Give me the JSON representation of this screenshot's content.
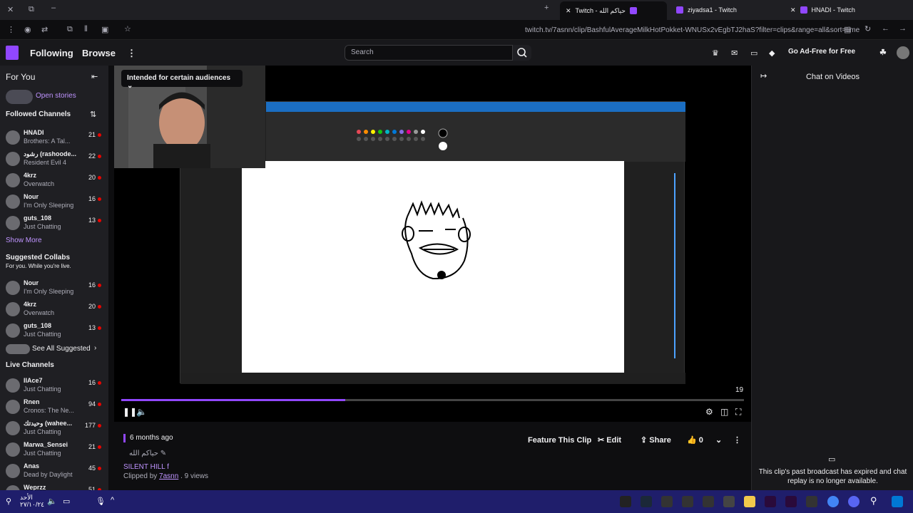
{
  "browser": {
    "tabs": [
      {
        "label": "Twitch - حياكم الله",
        "active": true
      },
      {
        "label": "ziyadsa1 - Twitch"
      },
      {
        "label": "HNADI - Twitch"
      }
    ],
    "url": "twitch.tv/7asnn/clip/BashfulAverageMilkHotPokket-WNUSx2vEgbTJ2haS?filter=clips&range=all&sort=time"
  },
  "topnav": {
    "following": "Following",
    "browse": "Browse",
    "search_placeholder": "Search",
    "adfree": "Go Ad-Free for Free"
  },
  "sidebar": {
    "for_you": "For You",
    "open_stories": "Open stories",
    "followed_heading": "Followed Channels",
    "followed": [
      {
        "name": "HNADI",
        "game": "Brothers: A Tal...",
        "viewers": "21"
      },
      {
        "name": "رشود (rashoode...",
        "game": "Resident Evil 4",
        "viewers": "22"
      },
      {
        "name": "4krz",
        "game": "Overwatch",
        "viewers": "20"
      },
      {
        "name": "Nour",
        "game": "I'm Only Sleeping",
        "viewers": "16"
      },
      {
        "name": "guts_108",
        "game": "Just Chatting",
        "viewers": "13"
      }
    ],
    "show_more": "Show More",
    "collabs_heading": "Suggested Collabs",
    "collabs_sub": "For you. While you're live.",
    "collabs": [
      {
        "name": "Nour",
        "game": "I'm Only Sleeping",
        "viewers": "16"
      },
      {
        "name": "4krz",
        "game": "Overwatch",
        "viewers": "20"
      },
      {
        "name": "guts_108",
        "game": "Just Chatting",
        "viewers": "13"
      }
    ],
    "see_all": "See All Suggested",
    "live_heading": "Live Channels",
    "live": [
      {
        "name": "IIAce7",
        "game": "Just Chatting",
        "viewers": "16"
      },
      {
        "name": "Rnen",
        "game": "Cronos: The Ne...",
        "viewers": "94"
      },
      {
        "name": "وحيدتك (wahee...",
        "game": "Just Chatting",
        "viewers": "177"
      },
      {
        "name": "Marwa_Sensei",
        "game": "Just Chatting",
        "viewers": "21"
      },
      {
        "name": "Anas",
        "game": "Dead by Daylight",
        "viewers": "45"
      },
      {
        "name": "Weprzz",
        "game": "",
        "viewers": "51"
      }
    ]
  },
  "player": {
    "audience_badge": "Intended for certain audiences",
    "counter": "19",
    "progress": 0.36
  },
  "clip": {
    "ago": "6 months ago",
    "title": "حياكم الله",
    "game": "SILENT HILL f",
    "clipped_by_prefix": "Clipped by",
    "clipper": "7asnn",
    "views": ". 9 views",
    "feature": "Feature This Clip",
    "edit": "Edit",
    "share": "Share",
    "likes": "0"
  },
  "chat": {
    "title": "Chat on Videos",
    "message": "This clip's past broadcast has expired and chat replay is no longer available."
  },
  "taskbar": {
    "time": "الأحد",
    "date": "٢٧/١٠/٢٤"
  },
  "colors": {
    "twitch_purple": "#9147ff",
    "link": "#bf94ff",
    "live_red": "#eb0400"
  }
}
